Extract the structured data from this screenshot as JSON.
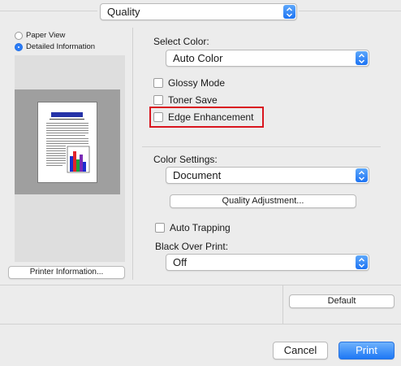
{
  "quality_popup": {
    "value": "Quality"
  },
  "left_panel": {
    "view_options": [
      {
        "label": "Paper View",
        "selected": false
      },
      {
        "label": "Detailed Information",
        "selected": true
      }
    ],
    "printer_info_button": "Printer Information..."
  },
  "select_color": {
    "label": "Select Color:",
    "value": "Auto Color"
  },
  "checkboxes": {
    "glossy_mode": "Glossy Mode",
    "toner_save": "Toner Save",
    "edge_enhancement": "Edge Enhancement"
  },
  "color_settings": {
    "label": "Color Settings:",
    "value": "Document"
  },
  "quality_adjustment_button": "Quality Adjustment...",
  "auto_trapping": "Auto Trapping",
  "black_over_print": {
    "label": "Black Over Print:",
    "value": "Off"
  },
  "default_button": "Default",
  "footer": {
    "cancel": "Cancel",
    "print": "Print"
  },
  "colors": {
    "accent": "#1e78f5",
    "highlight_border": "#d9161f",
    "bar_colors": [
      "#1b2fcf",
      "#e2242a",
      "#1ba23b",
      "#7a2bb5",
      "#1b2fcf"
    ]
  }
}
